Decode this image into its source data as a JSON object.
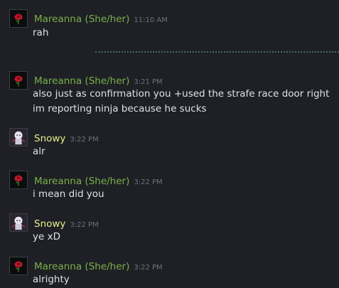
{
  "colors": {
    "background": "#1e2025",
    "user_green": "#7ab04a",
    "user_yellow": "#e8ee8a",
    "text": "#dfe1e4",
    "timestamp": "#6d717a"
  },
  "messages": [
    {
      "user": "Mareanna (She/her)",
      "time": "11:10 AM",
      "lines": [
        "rah"
      ],
      "avatar": "rose-avatar"
    },
    {
      "user": "Mareanna (She/her)",
      "time": "3:21 PM",
      "lines": [
        "also just as confirmation you +used the strafe race door right",
        "im reporting ninja because he sucks"
      ],
      "avatar": "rose-avatar"
    },
    {
      "user": "Snowy",
      "time": "3:22 PM",
      "lines": [
        "alr"
      ],
      "avatar": "snow-character-avatar"
    },
    {
      "user": "Mareanna (She/her)",
      "time": "3:22 PM",
      "lines": [
        "i mean did you"
      ],
      "avatar": "rose-avatar"
    },
    {
      "user": "Snowy",
      "time": "3:22 PM",
      "lines": [
        "ye xD"
      ],
      "avatar": "snow-character-avatar"
    },
    {
      "user": "Mareanna (She/her)",
      "time": "3:22 PM",
      "lines": [
        "alrighty"
      ],
      "avatar": "rose-avatar"
    }
  ]
}
